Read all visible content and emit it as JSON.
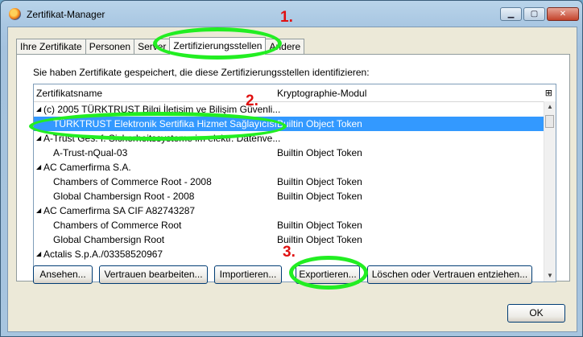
{
  "window": {
    "title": "Zertifikat-Manager",
    "icon": "firefox-icon"
  },
  "tabs": [
    {
      "label": "Ihre Zertifikate"
    },
    {
      "label": "Personen"
    },
    {
      "label": "Server"
    },
    {
      "label": "Zertifizierungsstellen",
      "active": true
    },
    {
      "label": "Andere"
    }
  ],
  "panel": {
    "intro": "Sie haben Zertifikate gespeichert, die diese Zertifizierungsstellen identifizieren:",
    "columns": {
      "name": "Zertifikatsname",
      "module": "Kryptographie-Modul"
    }
  },
  "rows": [
    {
      "type": "parent",
      "name": "(c) 2005 TÜRKTRUST Bilgi İletişim ve Bilişim Güvenli...",
      "module": ""
    },
    {
      "type": "child",
      "name": "TÜRKTRUST Elektronik Sertifika Hizmet Sağlayıcısı",
      "module": "Builtin Object Token",
      "selected": true
    },
    {
      "type": "parent",
      "name": "A-Trust Ges. f. Sicherheitssysteme im elektr. Datenve...",
      "module": ""
    },
    {
      "type": "child",
      "name": "A-Trust-nQual-03",
      "module": "Builtin Object Token"
    },
    {
      "type": "parent",
      "name": "AC Camerfirma S.A.",
      "module": ""
    },
    {
      "type": "child",
      "name": "Chambers of Commerce Root - 2008",
      "module": "Builtin Object Token"
    },
    {
      "type": "child",
      "name": "Global Chambersign Root - 2008",
      "module": "Builtin Object Token"
    },
    {
      "type": "parent",
      "name": "AC Camerfirma SA CIF A82743287",
      "module": ""
    },
    {
      "type": "child",
      "name": "Chambers of Commerce Root",
      "module": "Builtin Object Token"
    },
    {
      "type": "child",
      "name": "Global Chambersign Root",
      "module": "Builtin Object Token"
    },
    {
      "type": "parent",
      "name": "Actalis S.p.A./03358520967",
      "module": ""
    }
  ],
  "buttons": {
    "view": "Ansehen...",
    "edit_trust": "Vertrauen bearbeiten...",
    "import": "Importieren...",
    "export": "Exportieren...",
    "delete": "Löschen oder Vertrauen entziehen...",
    "ok": "OK"
  },
  "annotations": {
    "step1": "1.",
    "step2": "2.",
    "step3": "3.",
    "color": "#22ee22",
    "number_color": "#e01010"
  }
}
